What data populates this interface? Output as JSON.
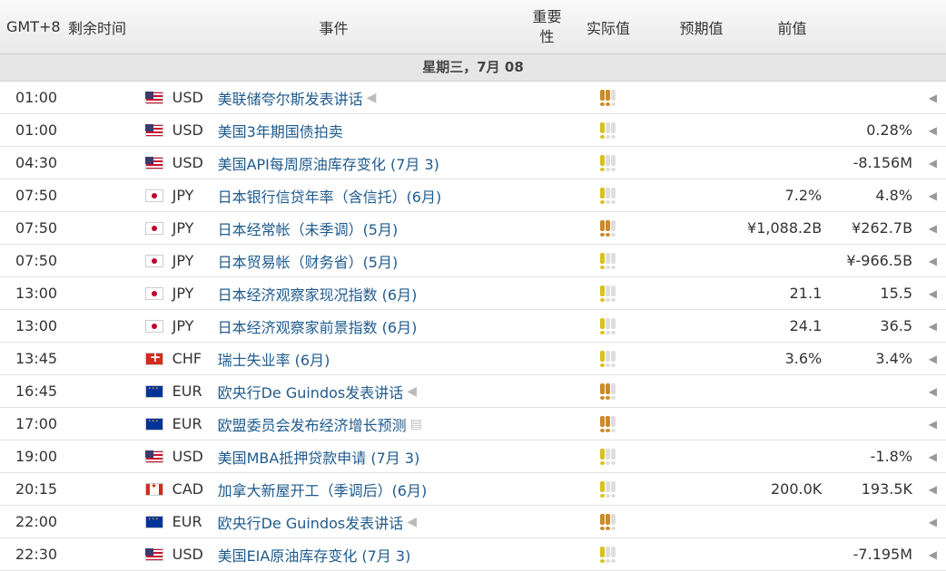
{
  "header": {
    "timezone": "GMT+8",
    "remaining": "剩余时间",
    "event": "事件",
    "importance": "重要性",
    "actual": "实际值",
    "forecast": "预期值",
    "previous": "前值"
  },
  "day": {
    "label": "星期三，7月 08"
  },
  "colors": {
    "link": "#1f5b8e",
    "imp_low": "#d9c21a",
    "imp_med": "#cc8a28",
    "imp_off": "#dedede"
  },
  "events": [
    {
      "time": "01:00",
      "flag": "us",
      "currency": "USD",
      "event": "美联储夸尔斯发表讲话",
      "icon": "speech-icon",
      "importance": 2,
      "color": "o",
      "actual": "",
      "forecast": "",
      "previous": ""
    },
    {
      "time": "01:00",
      "flag": "us",
      "currency": "USD",
      "event": "美国3年期国债拍卖",
      "icon": "",
      "importance": 1,
      "color": "y",
      "actual": "",
      "forecast": "",
      "previous": "0.28%"
    },
    {
      "time": "04:30",
      "flag": "us",
      "currency": "USD",
      "event": "美国API每周原油库存变化 (7月 3)",
      "icon": "",
      "importance": 1,
      "color": "y",
      "actual": "",
      "forecast": "",
      "previous": "-8.156M"
    },
    {
      "time": "07:50",
      "flag": "jp",
      "currency": "JPY",
      "event": "日本银行信贷年率（含信托）(6月)",
      "icon": "",
      "importance": 1,
      "color": "y",
      "actual": "",
      "forecast": "7.2%",
      "previous": "4.8%"
    },
    {
      "time": "07:50",
      "flag": "jp",
      "currency": "JPY",
      "event": "日本经常帐（未季调）(5月)",
      "icon": "",
      "importance": 2,
      "color": "o",
      "actual": "",
      "forecast": "¥1,088.2B",
      "previous": "¥262.7B"
    },
    {
      "time": "07:50",
      "flag": "jp",
      "currency": "JPY",
      "event": "日本贸易帐（财务省）(5月)",
      "icon": "",
      "importance": 1,
      "color": "y",
      "actual": "",
      "forecast": "",
      "previous": "¥-966.5B"
    },
    {
      "time": "13:00",
      "flag": "jp",
      "currency": "JPY",
      "event": "日本经济观察家现况指数 (6月)",
      "icon": "",
      "importance": 1,
      "color": "y",
      "actual": "",
      "forecast": "21.1",
      "previous": "15.5"
    },
    {
      "time": "13:00",
      "flag": "jp",
      "currency": "JPY",
      "event": "日本经济观察家前景指数 (6月)",
      "icon": "",
      "importance": 1,
      "color": "y",
      "actual": "",
      "forecast": "24.1",
      "previous": "36.5"
    },
    {
      "time": "13:45",
      "flag": "ch",
      "currency": "CHF",
      "event": "瑞士失业率 (6月)",
      "icon": "",
      "importance": 1,
      "color": "y",
      "actual": "",
      "forecast": "3.6%",
      "previous": "3.4%"
    },
    {
      "time": "16:45",
      "flag": "eu",
      "currency": "EUR",
      "event": "欧央行De Guindos发表讲话",
      "icon": "speech-icon",
      "importance": 2,
      "color": "o",
      "actual": "",
      "forecast": "",
      "previous": ""
    },
    {
      "time": "17:00",
      "flag": "eu",
      "currency": "EUR",
      "event": "欧盟委员会发布经济增长预测",
      "icon": "report-icon",
      "importance": 2,
      "color": "o",
      "actual": "",
      "forecast": "",
      "previous": ""
    },
    {
      "time": "19:00",
      "flag": "us",
      "currency": "USD",
      "event": "美国MBA抵押贷款申请 (7月 3)",
      "icon": "",
      "importance": 1,
      "color": "y",
      "actual": "",
      "forecast": "",
      "previous": "-1.8%"
    },
    {
      "time": "20:15",
      "flag": "ca",
      "currency": "CAD",
      "event": "加拿大新屋开工（季调后）(6月)",
      "icon": "",
      "importance": 1,
      "color": "y",
      "actual": "",
      "forecast": "200.0K",
      "previous": "193.5K"
    },
    {
      "time": "22:00",
      "flag": "eu",
      "currency": "EUR",
      "event": "欧央行De Guindos发表讲话",
      "icon": "speech-icon",
      "importance": 2,
      "color": "o",
      "actual": "",
      "forecast": "",
      "previous": ""
    },
    {
      "time": "22:30",
      "flag": "us",
      "currency": "USD",
      "event": "美国EIA原油库存变化 (7月 3)",
      "icon": "",
      "importance": 1,
      "color": "y",
      "actual": "",
      "forecast": "",
      "previous": "-7.195M"
    }
  ]
}
